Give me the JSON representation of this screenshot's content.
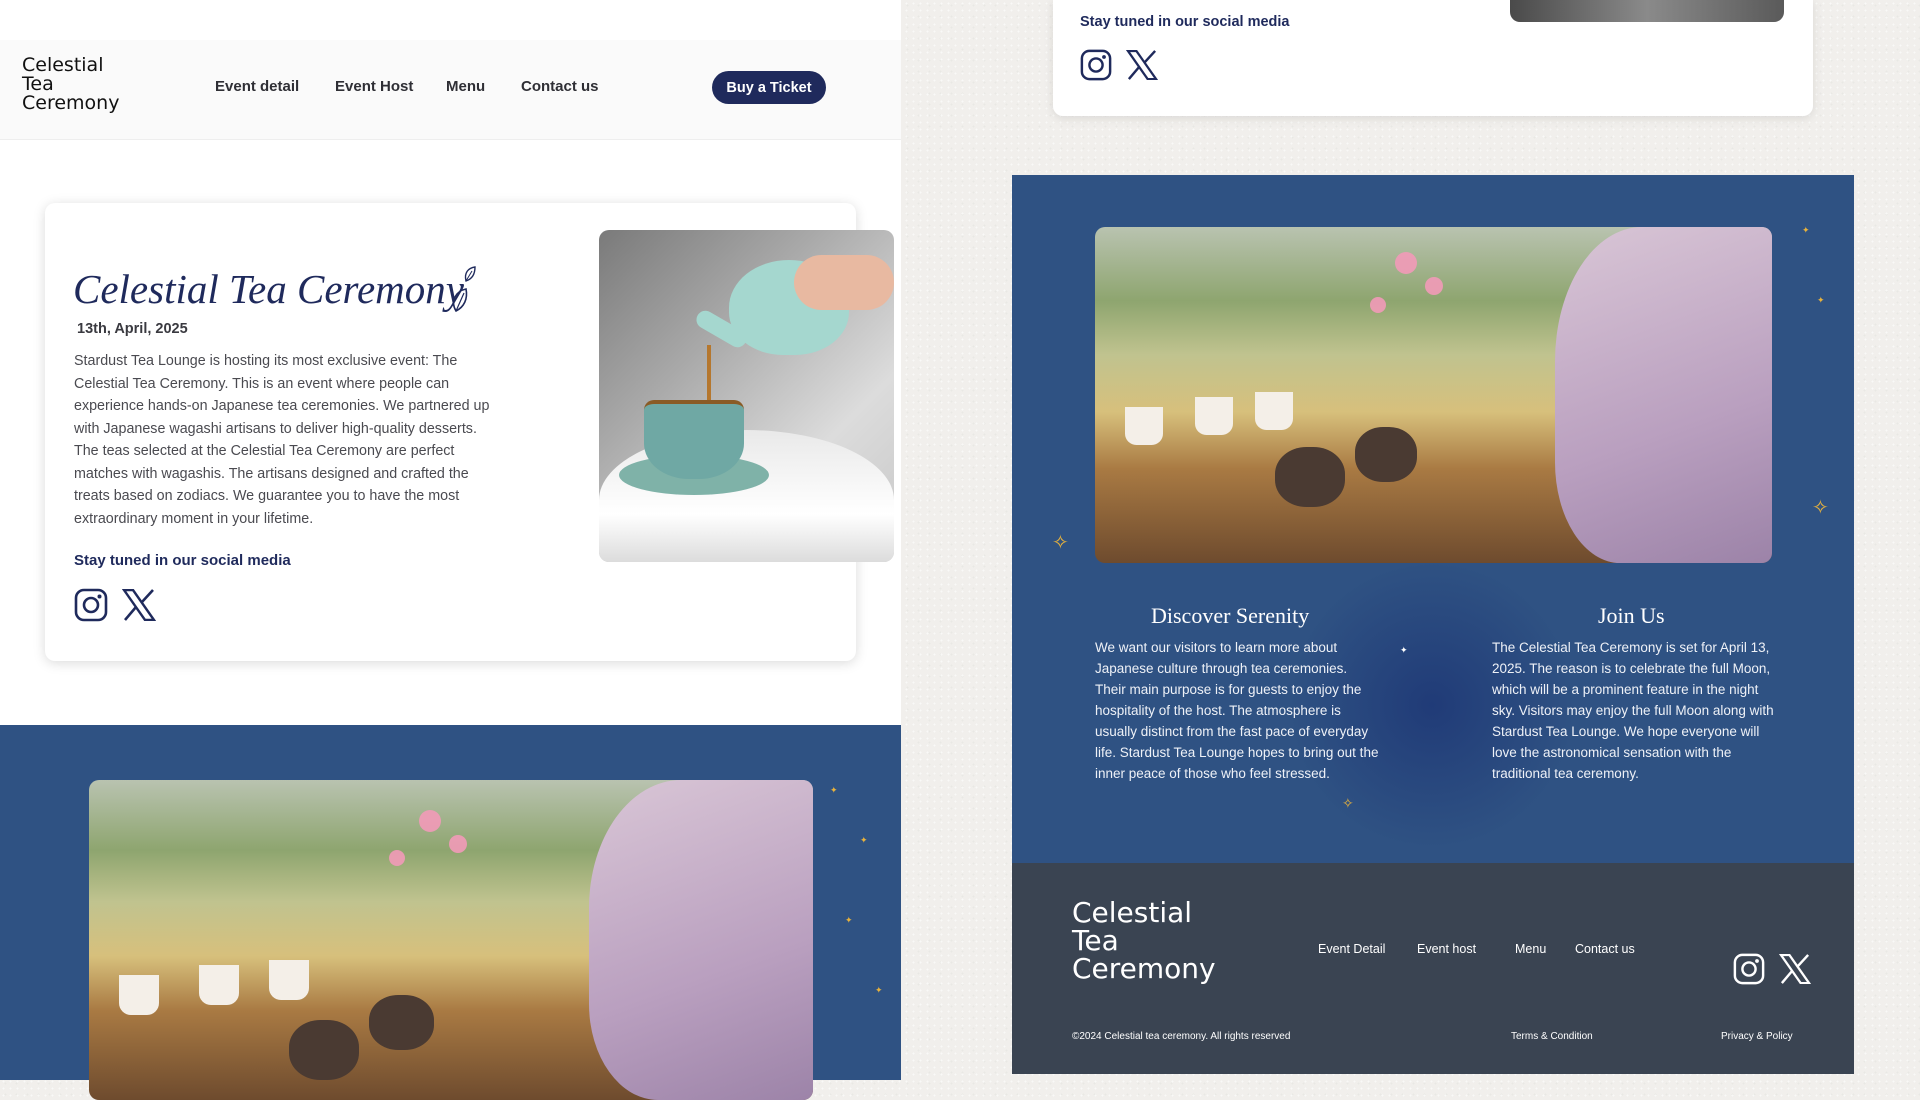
{
  "header": {
    "logo_line1": "Celestial",
    "logo_line2": "Tea",
    "logo_line3": "Ceremony",
    "nav": [
      "Event detail",
      "Event Host",
      "Menu",
      "Contact us"
    ],
    "cta": "Buy a Ticket"
  },
  "event_card": {
    "title": "Celestial Tea Ceremony",
    "date": "13th, April, 2025",
    "description": "Stardust Tea Lounge is hosting its most exclusive event: The Celestial Tea Ceremony. This is an event where people can experience hands-on Japanese tea ceremonies. We partnered up with Japanese wagashi artisans to deliver high-quality desserts. The teas selected at the Celestial Tea Ceremony are perfect matches with wagashis. The artisans designed and crafted the treats based on zodiacs. We guarantee you to have the most extraordinary moment in your lifetime.",
    "social_heading": "Stay tuned in our social media"
  },
  "right_top": {
    "social_heading": "Stay tuned in our social media"
  },
  "columns": [
    {
      "title": "Discover Serenity",
      "text": "We want our visitors to learn more about Japanese culture through tea ceremonies. Their main purpose is for guests to enjoy the hospitality of the host. The atmosphere is usually distinct from the fast pace of everyday life. Stardust Tea Lounge hopes to bring out the inner peace of those who feel stressed."
    },
    {
      "title": "Join Us",
      "text": "The Celestial Tea Ceremony is set for April 13, 2025. The reason is to celebrate the full Moon, which will be a prominent feature in the night sky. Visitors may enjoy the full Moon along with Stardust Tea Lounge. We hope everyone will love the astronomical sensation with the traditional tea ceremony."
    }
  ],
  "footer": {
    "logo_line1": "Celestial",
    "logo_line2": "Tea",
    "logo_line3": "Ceremony",
    "links": [
      "Event Detail",
      "Event host",
      "Menu",
      "Contact us"
    ],
    "copyright": "©2024 Celestial tea ceremony. All rights reserved",
    "terms": "Terms & Condition",
    "privacy": "Privacy & Policy"
  },
  "icons": [
    "instagram-icon",
    "x-twitter-icon",
    "leaf-icon",
    "sparkle-icon"
  ],
  "colors": {
    "navy": "#1f2a5c",
    "blue_section": "#2f5283",
    "footer": "#3a4452",
    "gold": "#e9b33c"
  }
}
